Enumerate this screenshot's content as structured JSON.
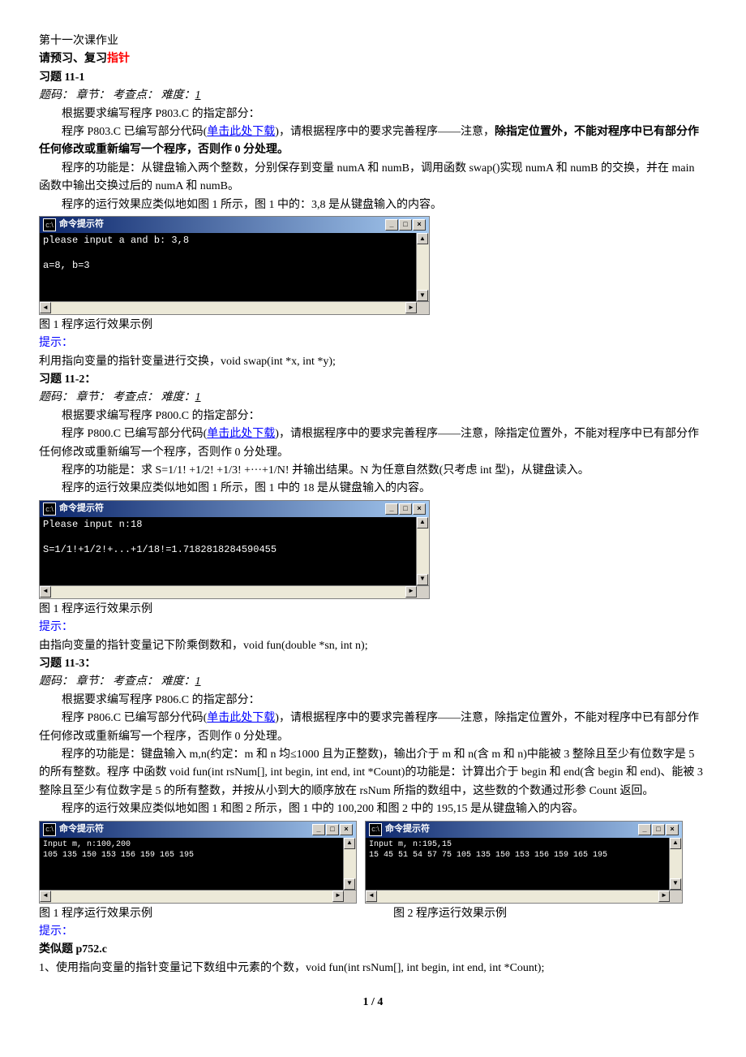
{
  "header": "第十一次课作业",
  "review_prefix": "请预习、复习",
  "review_red": "指针",
  "ex11_1": {
    "title": "习题 11-1",
    "meta": "题码：      章节：      考查点：      难度：",
    "difficulty": "1",
    "p1": "根据要求编写程序 P803.C 的指定部分：",
    "p2a": "程序 P803.C 已编写部分代码(",
    "link": "单击此处下载",
    "p2b": ")，请根据程序中的要求完善程序——注意，",
    "p2c_bold": "除指定位置外，不能对程序中已有部分作任何修改或重新编写一个程序，否则作 0 分处理。",
    "p3": "程序的功能是：从键盘输入两个整数，分别保存到变量 numA 和 numB，调用函数 swap()实现 numA 和 numB 的交换，并在 main 函数中输出交换过后的 numA 和 numB。",
    "p4": "程序的运行效果应类似地如图 1 所示，图 1 中的：3,8 是从键盘输入的内容。",
    "con_title": "命令提示符",
    "con_text": "please input a and b: 3,8\n\na=8, b=3",
    "fig1": "图 1  程序运行效果示例",
    "hint_label": "提示：",
    "hint": "利用指向变量的指针变量进行交换，void swap(int *x, int *y);"
  },
  "ex11_2": {
    "title": "习题 11-2：",
    "meta": "题码：      章节：      考查点：      难度：",
    "difficulty": "1",
    "p1": "根据要求编写程序 P800.C 的指定部分：",
    "p2a": "程序 P800.C 已编写部分代码(",
    "link": "单击此处下载",
    "p2b": ")，请根据程序中的要求完善程序——注意，除指定位置外，不能对程序中已有部分作任何修改或重新编写一个程序，否则作 0 分处理。",
    "p3": "程序的功能是：求 S=1/1! +1/2! +1/3! +···+1/N! 并输出结果。N 为任意自然数(只考虑 int 型)，从键盘读入。",
    "p4": "程序的运行效果应类似地如图 1 所示，图 1 中的 18 是从键盘输入的内容。",
    "con_title": "命令提示符",
    "con_text": "Please input n:18\n\nS=1/1!+1/2!+...+1/18!=1.7182818284590455",
    "fig1": "图 1  程序运行效果示例",
    "hint_label": "提示：",
    "hint": "由指向变量的指针变量记下阶乘倒数和，void fun(double *sn, int n);"
  },
  "ex11_3": {
    "title": "习题 11-3：",
    "meta": "题码：      章节：      考查点：      难度：",
    "difficulty": "1",
    "p1": "根据要求编写程序 P806.C 的指定部分：",
    "p2a": "程序 P806.C 已编写部分代码(",
    "link": "单击此处下载",
    "p2b": ")，请根据程序中的要求完善程序——注意，除指定位置外，不能对程序中已有部分作任何修改或重新编写一个程序，否则作 0 分处理。",
    "p3": "程序的功能是：键盘输入 m,n(约定：m 和 n 均≤1000 且为正整数)，输出介于 m 和 n(含 m 和 n)中能被 3 整除且至少有位数字是 5 的所有整数。程序 中函数 void  fun(int  rsNum[],  int  begin,  int  end,  int  *Count)的功能是：计算出介于 begin 和 end(含 begin 和 end)、能被 3 整除且至少有位数字是 5 的所有整数，并按从小到大的顺序放在 rsNum 所指的数组中，这些数的个数通过形参 Count 返回。",
    "p4": "程序的运行效果应类似地如图 1 和图 2 所示，图 1 中的 100,200 和图 2 中的 195,15 是从键盘输入的内容。",
    "con_title": "命令提示符",
    "con1_text": "Input m, n:100,200\n105 135 150 153 156 159 165 195",
    "con2_text": "Input m, n:195,15\n15 45 51 54 57 75 105 135 150 153 156 159 165 195",
    "fig1": "图 1  程序运行效果示例",
    "fig2": "图 2  程序运行效果示例",
    "hint_label": "提示：",
    "similar": "类似题 p752.c",
    "hint": "1、使用指向变量的指针变量记下数组中元素的个数，void fun(int rsNum[], int begin, int end, int *Count);"
  },
  "page_num": "1 / 4"
}
